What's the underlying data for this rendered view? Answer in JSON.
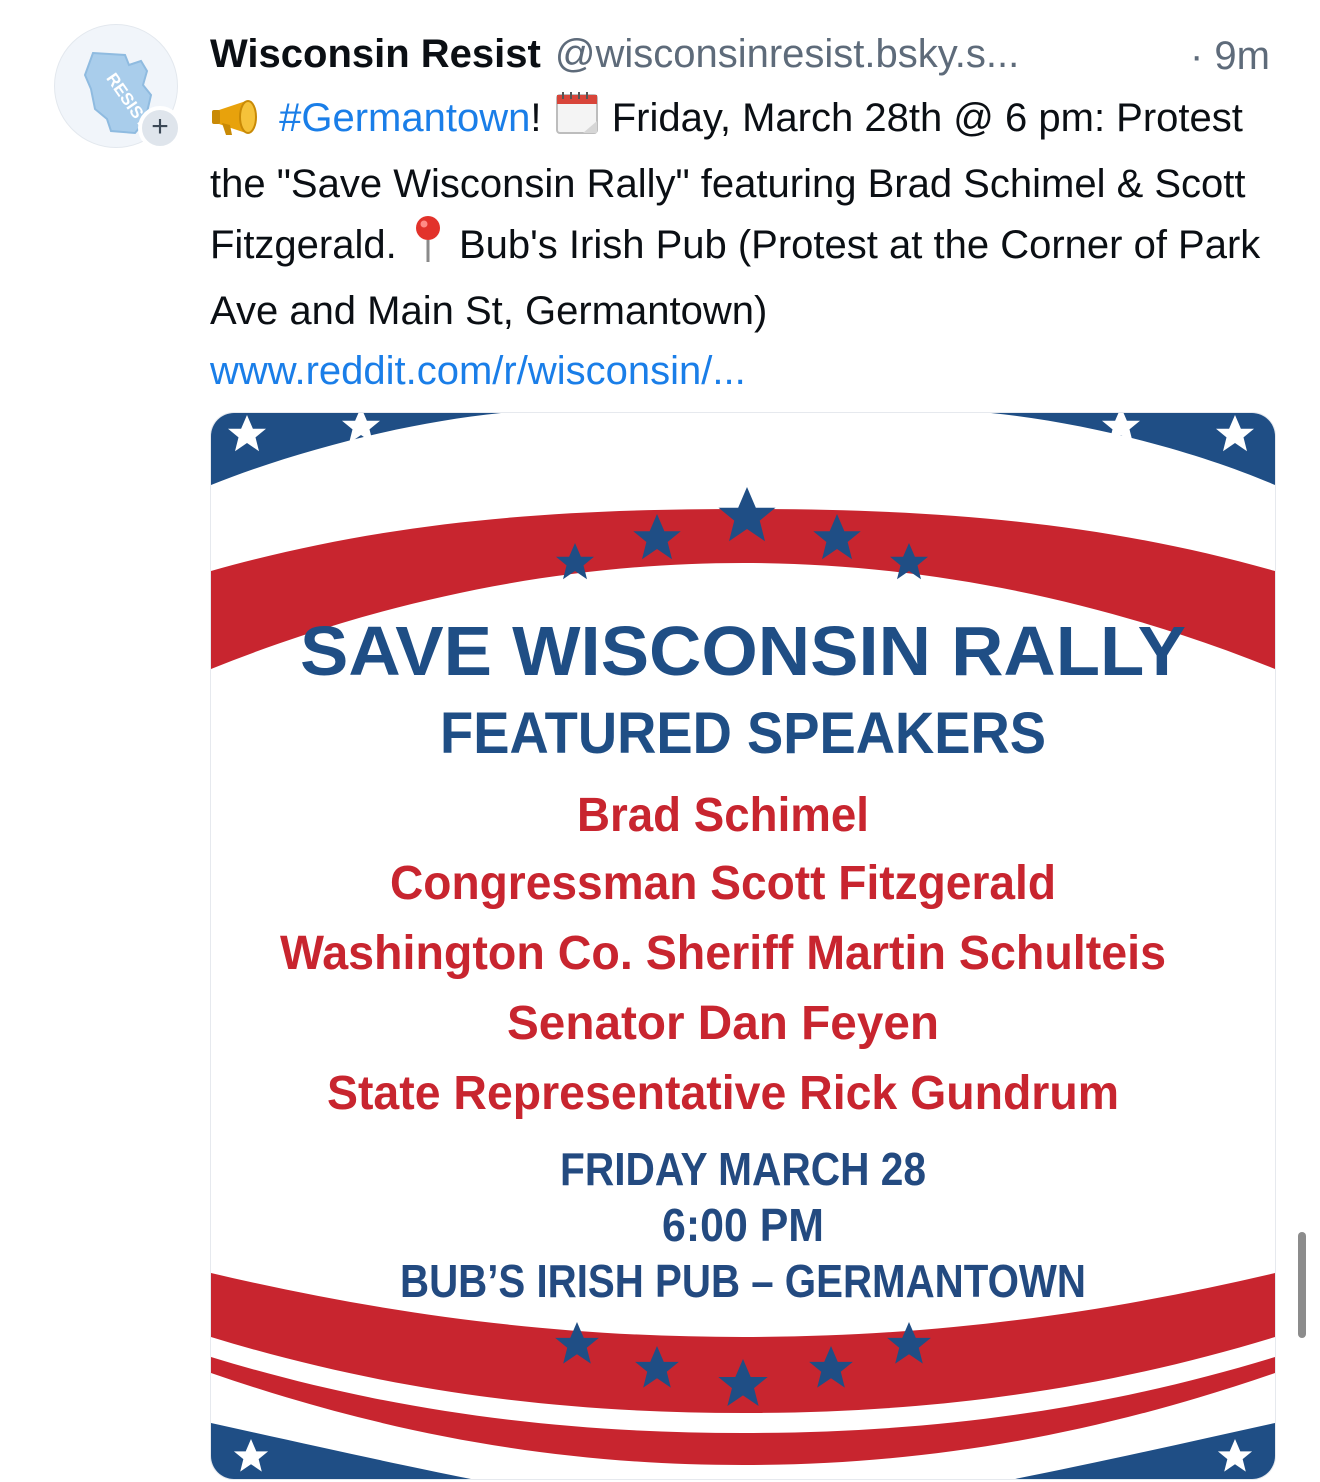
{
  "author": {
    "name": "Wisconsin Resist",
    "handle": "@wisconsinresist.bsky.s...",
    "time": "· 9m",
    "avatar_label": "RESIST",
    "follow_icon": "+"
  },
  "post": {
    "hashtag": "#Germantown",
    "text_1": "! ",
    "text_2": " Friday, March 28th @ 6 pm: Protest the \"Save Wisconsin Rally\" featuring Brad Schimel & Scott Fitzgerald. ",
    "text_3": " Bub's Irish Pub (Protest at the Corner of Park Ave and Main St, Germantown) ",
    "link": "www.reddit.com/r/wisconsin/...",
    "icons": [
      "megaphone-icon",
      "calendar-icon",
      "pushpin-icon"
    ]
  },
  "flyer": {
    "title": "SAVE WISCONSIN RALLY",
    "subtitle": "FEATURED SPEAKERS",
    "speakers": [
      "Brad Schimel",
      "Congressman Scott Fitzgerald",
      "Washington Co. Sheriff Martin Schulteis",
      "Senator Dan Feyen",
      "State Representative Rick Gundrum"
    ],
    "date": "FRIDAY MARCH 28",
    "time": "6:00 PM",
    "venue": "BUB’S IRISH PUB – GERMANTOWN",
    "colors": {
      "blue": "#1f4e85",
      "red": "#c8252f",
      "navy": "#234a80"
    }
  }
}
